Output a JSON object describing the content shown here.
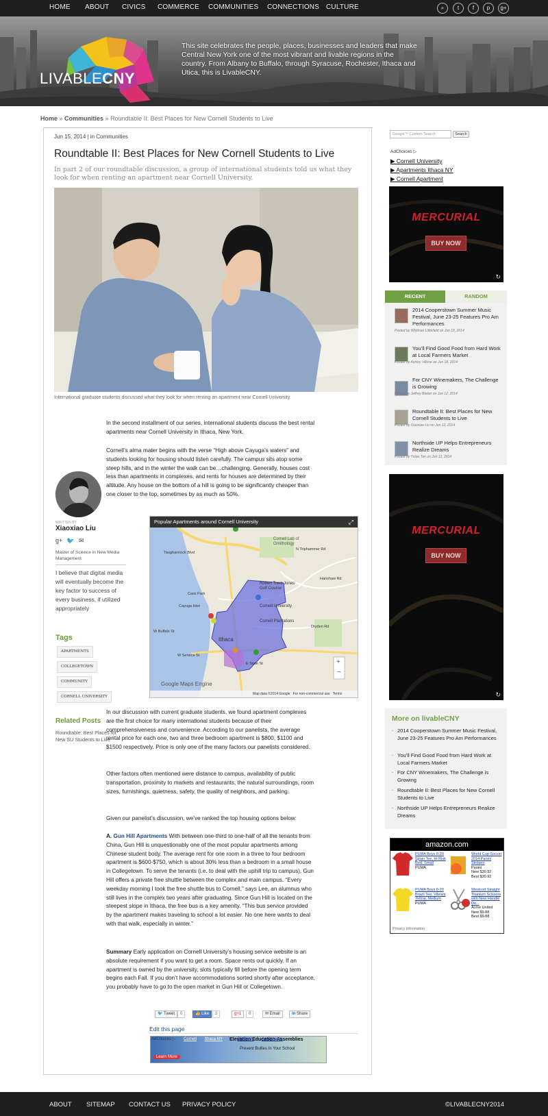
{
  "nav": {
    "items": [
      "HOME",
      "ABOUT",
      "CIVICS",
      "COMMERCE",
      "COMMUNITIES",
      "CONNECTIONS",
      "CULTURE"
    ],
    "social_icons": [
      "search-icon",
      "twitter-icon",
      "facebook-icon",
      "pinterest-icon",
      "google-plus-icon"
    ]
  },
  "banner": {
    "logo_light": "LIVABLE",
    "logo_bold": "CNY",
    "tagline": "This site celebrates the people, places, businesses and leaders that make Central New York one of the most vibrant and livable regions in the country. From Albany to Buffalo, through Syracuse, Rochester, Ithaca and Utica, this is LivableCNY."
  },
  "breadcrumb": {
    "home": "Home",
    "sep1": " » ",
    "section": "Communities",
    "sep2": " » ",
    "current": "Roundtable II: Best Places for New Cornell Students to Live"
  },
  "article": {
    "meta": "Jun 15, 2014 | in Communities",
    "title": "Roundtable II: Best Places for New Cornell Students to Live",
    "subtitle": "In part 2 of our roundtable discussion, a group of international students told us what they look for when renting an apartment near Cornell University.",
    "caption": "International graduate students discussed what they look for when renting an apartment near Cornell University.",
    "p1": "In the second installment of our series,  international students discuss the best  rental apartments near Cornell University in Ithaca, New York.",
    "p2": "Cornell’s alma mater begins with the verse “High above Cayuga’s waters” and students looking for housing should listen carefully. The campus sits atop some steep hills, and in the winter the walk can be…challenging. Generally, houses cost less than apartments in complexes, and rents for houses are determined by their altitude.  Any house on the bottom of a hill is going to be significantly cheaper than one closer to the top, sometimes by as much as 50%.",
    "p3": "In our discussion with current graduate students, we found apartment complexes are the first choice for many international students because of their comprehensiveness and convenience. According to our panelists, the average rental price for each one, two and three bedroom apartment is $800, $1100 and $1500 respectively. Price is only one of the many factors our panelists considered.",
    "p4": "Other factors often mentioned were distance to campus, availability of public transportation, proximity to markets and restaurants, the natural surroundings, room sizes, furnishings, quietness, safety, the quality of neighbors, and parking.",
    "p5": "Given our panelist’s discussion, we’ve ranked the top housing options below:",
    "p6_prefix": "A. ",
    "p6_link": "Gun Hill Apartments",
    "p6_body": " With between one-third to one-half of all the tenants from China, Gun Hill is unquestionably one of the most popular apartments among Chinese student body. The average rent for one room in a three to four bedroom apartment is $600-$750, which is about 30% less than a bedroom in a small house in Collegetown. To serve the tenants (i.e. to deal with the uphill trip to campus), Gun Hill offers a private free shuttle between the complex and main campus. “Every weekday morning I took the free shuttle bus to Cornell,” says Lee, an alumnus who still lives in the complex two years after graduating. Since Gun Hill is located on the steepest slope in Ithaca, the free bus is a key amenity. “This bus service provided by the apartment makes traveling to school a lot easier.  No one here wants to deal with that walk, especially in winter.”",
    "p7_bold": "Summary",
    "p7_body": " Early application on Cornell University’s housing service website is an absolute requirement if you want to get a room. Space rents out quickly. If an apartment is owned by the university, slots typically fill before the opening term begins each Fall. If you don’t have accommodations sorted shortly after acceptance, you probably have to go to the open market in Gun Hill or Collegetown.",
    "edit_page": "Edit this page"
  },
  "map": {
    "title": "Popular Apartments around Cornell University",
    "labels": [
      "Cornell Lab of Ornithology",
      "Robert Trent Jones Golf Course",
      "Cornell University",
      "Cornell Plantations",
      "Ithaca",
      "W Seneca St",
      "E State St",
      "Dryden Rd",
      "Hanshaw Rd",
      "N Triphammer Rd",
      "W Buffalo St",
      "Cayuga Inlet",
      "Taughannock Blvd",
      "Cass Park"
    ],
    "engine": "Google Maps Engine",
    "footer": "Map data ©2014 Google   For non-commercial use   Terms"
  },
  "share": {
    "tweet": "Tweet",
    "tweet_count": "0",
    "like": "Like",
    "like_count": "2",
    "gplus": "+1",
    "gplus_count": "0",
    "email": "Email",
    "linkedin": "Share"
  },
  "bottom_ad": {
    "adchoices": "AdChoices ▷",
    "links": [
      "Cornell",
      "Ithaca NY",
      "Students",
      "Apartments"
    ],
    "headline": "Elevation Education Assemblies",
    "sub": "Prevent Bullies In Your School",
    "cta": "Learn More"
  },
  "author": {
    "written_by": "WRITTEN BY",
    "name": "Xiaoxiao Liu",
    "degree": "Master of Science in New Media Management",
    "bio": "I believe that digital media will eventually become the key factor to success of every business, if utilized appropriately"
  },
  "tags": {
    "heading": "Tags",
    "items": [
      "APARTMENTS",
      "COLLEGETOWN",
      "COMMUNITY",
      "CORNELL UNIVERSITY"
    ]
  },
  "related": {
    "heading": "Related Posts",
    "items": [
      "Roundtable: Best Places for New SU Students to Live"
    ]
  },
  "sidebar": {
    "search_placeholder": "Google™ Custom Search",
    "search_button": "Search",
    "adchoices": "AdChoices ▷",
    "ad_links": [
      "▶ Cornell University",
      "▶ Apartments Ithaca NY",
      "▶ Cornell Apartment"
    ],
    "ad_brand": "MERCURIAL",
    "ad_cta": "BUY NOW",
    "tab_recent": "RECENT",
    "tab_random": "RANDOM",
    "recent": [
      {
        "title": "2014 Cooperstown Summer Music Festival, June 23-25 Features Pro Am Performances",
        "byline": "Posted by Whitman Littlefield on Jun 18, 2014"
      },
      {
        "title": "You’ll Find Good Food from Hard Work at Local Farmers Market",
        "byline": "Posted by Ashley Villone on Jun 18, 2014"
      },
      {
        "title": "For CNY Winemakers, The Challenge is Growing",
        "byline": "Posted by Jeffrey Bieber on Jun 12, 2014"
      },
      {
        "title": "Roundtable II: Best Places for New Cornell Students to Live",
        "byline": "Posted by Xiaoxiao Liu on Jun 12, 2014"
      },
      {
        "title": "Northside UP Helps Entrepreneurs Realize Dreams",
        "byline": "Posted by Yutao Tan on Jun 12, 2014"
      }
    ],
    "more_title": "More on livableCNY",
    "more": [
      "2014 Cooperstown Summer Music Festival, June 23-25 Features Pro Am Performances",
      "You’ll Find Good Food from Hard Work at Local Farmers Market",
      "For CNY Winemakers, The Challenge is Growing",
      "Roundtable II: Best Places for New Cornell Students to Live",
      "Northside UP Helps Entrepreneurs Realize Dreams"
    ],
    "amazon": {
      "logo": "amazon.com",
      "p1_link": "PUMA Boys 8-20 Spain Tee, Hi Risk Red, Small",
      "p1_brand": "PUMA",
      "p2_link": "World Cup Soccer 2014 Panini Stickers",
      "p2_brand": "Panini",
      "p2_new": "New $30.92",
      "p2_best": "Best $30.92",
      "p3_link": "PUMA Boys 8-20 Brazil Tee, Vibrant Yellow, Medium",
      "p3_brand": "PUMA",
      "p4_link": "Westcott Straight Titanium Scissors with New Handle De...",
      "p4_brand": "Acme United",
      "p4_new": "New $9.88",
      "p4_best": "Best $9.88",
      "privacy": "Privacy Information"
    }
  },
  "footer": {
    "items": [
      "ABOUT",
      "SITEMAP",
      "CONTACT US",
      "PRIVACY POLICY"
    ],
    "copyright": "©LIVABLECNY2014"
  },
  "colors": {
    "accent_green": "#6fa043",
    "link_blue": "#1f4b8f",
    "nav_bg": "#1f1f1f",
    "mercurial_red": "#d1202f"
  }
}
